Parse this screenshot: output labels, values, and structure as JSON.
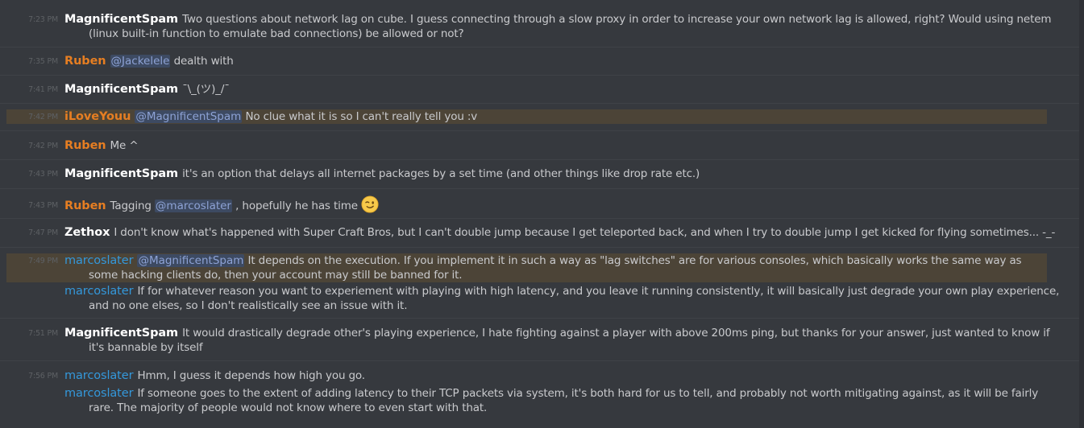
{
  "colors": {
    "background": "#36393e",
    "white_user": "#ffffff",
    "orange_user": "#e67e22",
    "blue_user": "#3498db",
    "mention_bg": "#3d4a62",
    "mention_fg": "#8da2d5",
    "highlight_bg": "#4c4437"
  },
  "messages": [
    {
      "time": "7:23 PM",
      "author": "MagnificentSpam",
      "text": "Two questions about network lag on cube. I guess connecting through a slow proxy in order to increase your own network lag is allowed, right? Would using netem (linux built-in function to emulate bad connections) be allowed or not?"
    },
    {
      "time": "7:35 PM",
      "author": "Ruben",
      "mention": "@Jackelele",
      "text": " dealth with"
    },
    {
      "time": "7:41 PM",
      "author": "MagnificentSpam",
      "text": "¯\\_(ツ)_/¯"
    },
    {
      "time": "7:42 PM",
      "author": "iLoveYouu",
      "mention": "@MagnificentSpam",
      "text": " No clue what it is so I can't really tell you :v"
    },
    {
      "time": "7:42 PM",
      "author": "Ruben",
      "text": "Me ^"
    },
    {
      "time": "7:43 PM",
      "author": "MagnificentSpam",
      "text": "it's an option that delays all internet packages by a set time (and other things like drop rate etc.)"
    },
    {
      "time": "7:43 PM",
      "author": "Ruben",
      "text_before": "Tagging ",
      "mention": "@marcoslater",
      "text": " , hopefully he has time",
      "emoji": "wink-emoji"
    },
    {
      "time": "7:47 PM",
      "author": "Zethox",
      "text": "I don't know what's happened with Super Craft Bros, but I can't double jump because I get teleported back, and when I try to double jump I get kicked for flying sometimes... -_-"
    },
    {
      "time": "7:49 PM",
      "author": "marcoslater",
      "mention": "@MagnificentSpam",
      "text": " It depends on the execution. If you implement it in such a way as \"lag switches\" are for various consoles, which basically works the same way as some hacking clients do, then your account may still be banned for it.",
      "followup_author": "marcoslater",
      "followup_text": "If for whatever reason you want to experiement with playing with high latency, and you leave it running consistently, it will basically just degrade your own play experience, and no one elses, so I don't realistically see an issue with it."
    },
    {
      "time": "7:51 PM",
      "author": "MagnificentSpam",
      "text": "It would drastically degrade other's playing experience, I hate fighting against a player with above 200ms ping, but thanks for your answer, just wanted to know if it's bannable by itself"
    },
    {
      "time": "7:56 PM",
      "author": "marcoslater",
      "text": "Hmm, I guess it depends how high you go.",
      "followup_author": "marcoslater",
      "followup_text": "If someone goes to the extent of adding latency to their TCP packets via system, it's both hard for us to tell, and probably not worth mitigating against, as it will be fairly rare. The majority of people would not know where to even start with that."
    }
  ]
}
